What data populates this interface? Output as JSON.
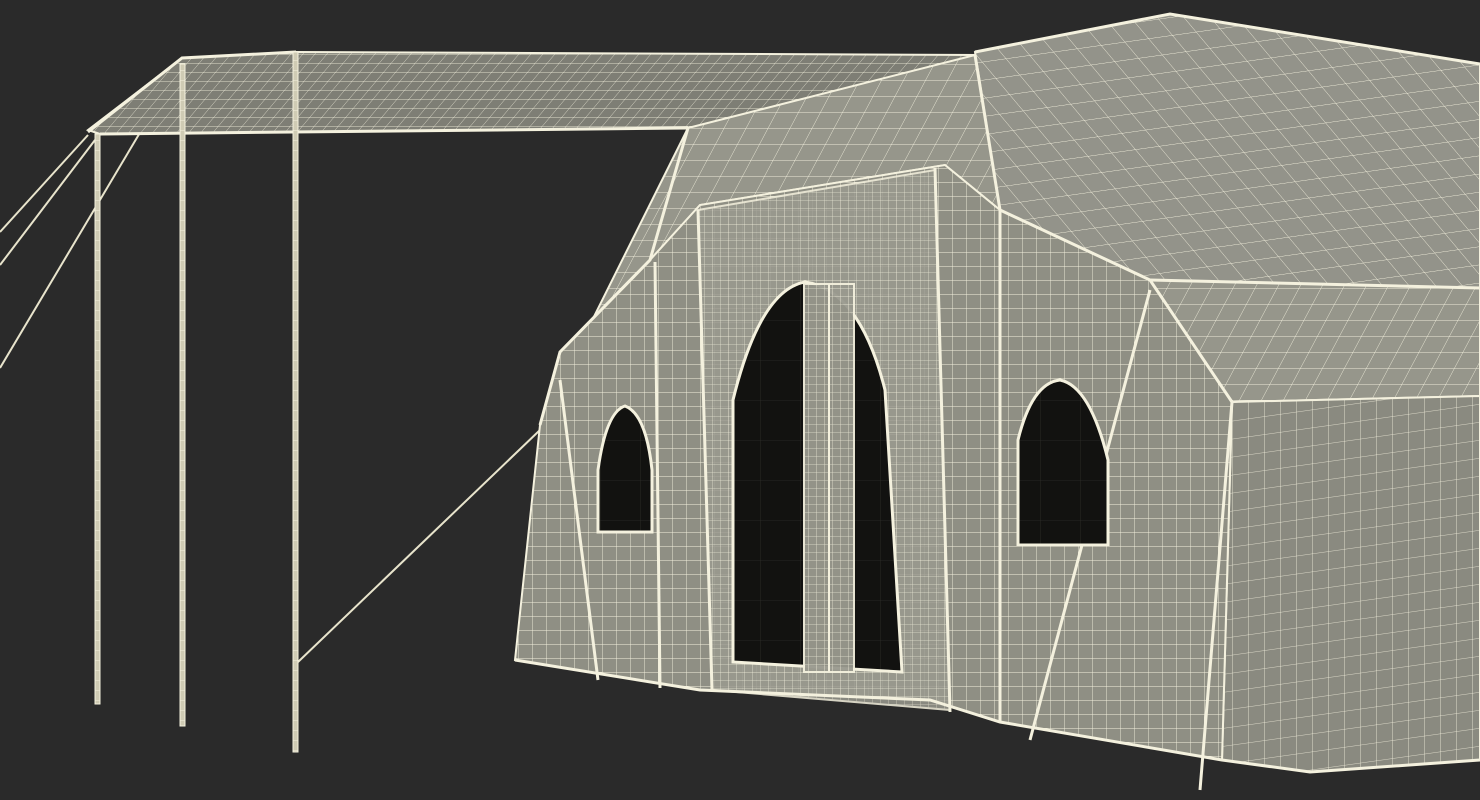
{
  "scene": {
    "subject": "tent-wireframe-render",
    "colors": {
      "background": "#2a2a2a",
      "canvas_fill": "#8f8f84",
      "canvas_fill_light": "#a3a398",
      "canvas_fill_dark": "#7c7c72",
      "wire": "#f4f1de",
      "opening": "#121210",
      "pole": "#e8e4cc"
    },
    "icons": {
      "awning": "awning-panel",
      "poles": "support-pole",
      "guy_lines": "guy-rope",
      "door": "arched-doorway",
      "windows": "arched-window"
    }
  }
}
